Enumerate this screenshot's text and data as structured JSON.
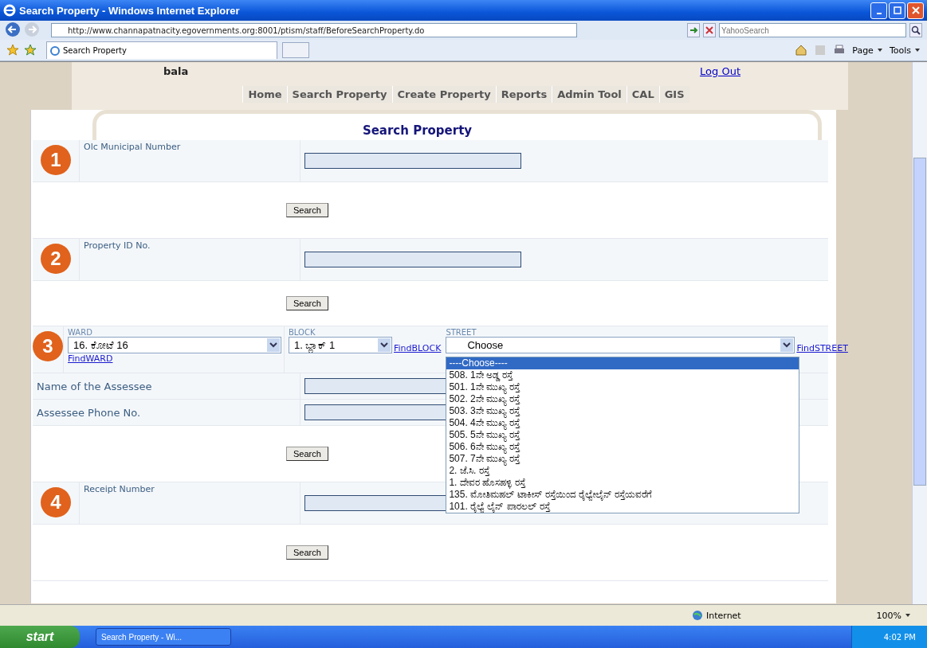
{
  "window": {
    "title": "Search Property - Windows Internet Explorer"
  },
  "address_bar": {
    "url": "http://www.channapatnacity.egovernments.org:8001/ptism/staff/BeforeSearchProperty.do",
    "search_placeholder": "YahooSearch"
  },
  "tab": {
    "label": "Search Property"
  },
  "toolbar": [
    "Page",
    "Tools"
  ],
  "page": {
    "user": "bala",
    "logout": "Log Out",
    "nav": [
      "Home",
      "Search Property",
      "Create Property",
      "Reports",
      "Admin Tool",
      "CAL",
      "GIS"
    ],
    "heading": "Search Property",
    "sections": [
      {
        "number": "1",
        "kind": "single",
        "label": "Olc Municipal Number",
        "button": "Search"
      },
      {
        "number": "2",
        "kind": "single",
        "label": "Property ID No.",
        "button": "Search"
      },
      {
        "number": "3",
        "kind": "location",
        "ward": {
          "label": "WARD",
          "value": "16. ಕೋಟೆ 16",
          "link": "FindWARD"
        },
        "block": {
          "label": "BLOCK",
          "value": "1. ಬ್ಲಾಕ್ 1",
          "link": "FindBLOCK"
        },
        "street": {
          "label": "STREET",
          "value": "Choose",
          "link": "FindSTREET",
          "expanded": true,
          "options": [
            {
              "label": "----Choose----",
              "selected": true
            },
            {
              "label": "508. 1ನೇ ಅಡ್ಡ ರಸ್ತೆ",
              "selected": false
            },
            {
              "label": "501. 1ನೇ ಮುಖ್ಯ ರಸ್ತೆ",
              "selected": false
            },
            {
              "label": "502. 2ನೇ ಮುಖ್ಯ ರಸ್ತೆ",
              "selected": false
            },
            {
              "label": "503. 3ನೇ ಮುಖ್ಯ ರಸ್ತೆ",
              "selected": false
            },
            {
              "label": "504. 4ನೇ ಮುಖ್ಯ ರಸ್ತೆ",
              "selected": false
            },
            {
              "label": "505. 5ನೇ ಮುಖ್ಯ ರಸ್ತೆ",
              "selected": false
            },
            {
              "label": "506. 6ನೇ ಮುಖ್ಯ ರಸ್ತೆ",
              "selected": false
            },
            {
              "label": "507. 7ನೇ ಮುಖ್ಯ ರಸ್ತೆ",
              "selected": false
            },
            {
              "label": "2. ಜೆ.ಸಿ. ರಸ್ತೆ",
              "selected": false
            },
            {
              "label": "1. ದೇವರ ಹೊಸಹಳ್ಳಿ ರಸ್ತೆ",
              "selected": false
            },
            {
              "label": "135. ಮೋತಿಮಹಲ್ ಟಾಕೀಸ್ ರಸ್ತೆಯಿಂದ ರೈಲ್ವೇಲೈನ್ ರಸ್ತೆಯವರೆಗೆ",
              "selected": false
            },
            {
              "label": "101. ರೈಲ್ವೆ ಲೈನ್ ಪಾರಲಲ್ ರಸ್ತೆ",
              "selected": false
            }
          ]
        },
        "fields": [
          {
            "label": "Name of the Assessee"
          },
          {
            "label": "Assessee Phone No."
          }
        ],
        "button": "Search"
      },
      {
        "number": "4",
        "kind": "single",
        "label": "Receipt Number",
        "button": "Search"
      }
    ]
  },
  "status_bar": {
    "zone": "Internet",
    "zoom": "100%"
  },
  "taskbar": {
    "start": "start",
    "task": "Search Property - Wi...",
    "time": "4:02 PM"
  }
}
